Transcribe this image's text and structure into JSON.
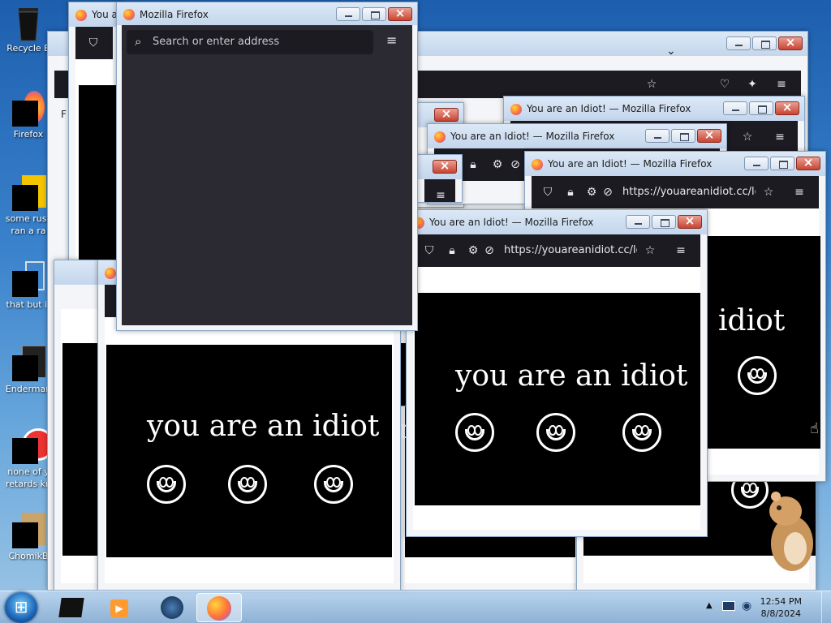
{
  "desktop": {
    "icons": [
      {
        "label": "Recycle B",
        "icon": "recycle-bin-icon"
      },
      {
        "label": "Firefox",
        "icon": "firefox-icon"
      },
      {
        "label": "some russ",
        "label2": "ran a ra",
        "icon": "file-icon"
      },
      {
        "label": "that but it",
        "icon": "file-icon"
      },
      {
        "label": "Enderman",
        "icon": "file-icon"
      },
      {
        "label": "none of y",
        "label2": "retards kn",
        "icon": "file-icon"
      },
      {
        "label": "ChomikB",
        "icon": "hamster-icon"
      }
    ]
  },
  "windows": {
    "main": {
      "title": "Mozilla Firefox",
      "search_placeholder": "Search or enter address"
    },
    "idiot": {
      "title": "You are an Idiot! — Mozilla Firefox",
      "title_short": "You a",
      "url": "https://youareanidiot.cc/lol."
    },
    "page_text": "you are an idiot",
    "page_text_partial": "idiot",
    "letter_fragment": "r",
    "edge_fragment": "F"
  },
  "taskbar": {
    "time": "12:54 PM",
    "date": "8/8/2024"
  },
  "colors": {
    "toolbar": "#1c1b22",
    "page_bg": "#000000",
    "accent": "#ff7139"
  }
}
